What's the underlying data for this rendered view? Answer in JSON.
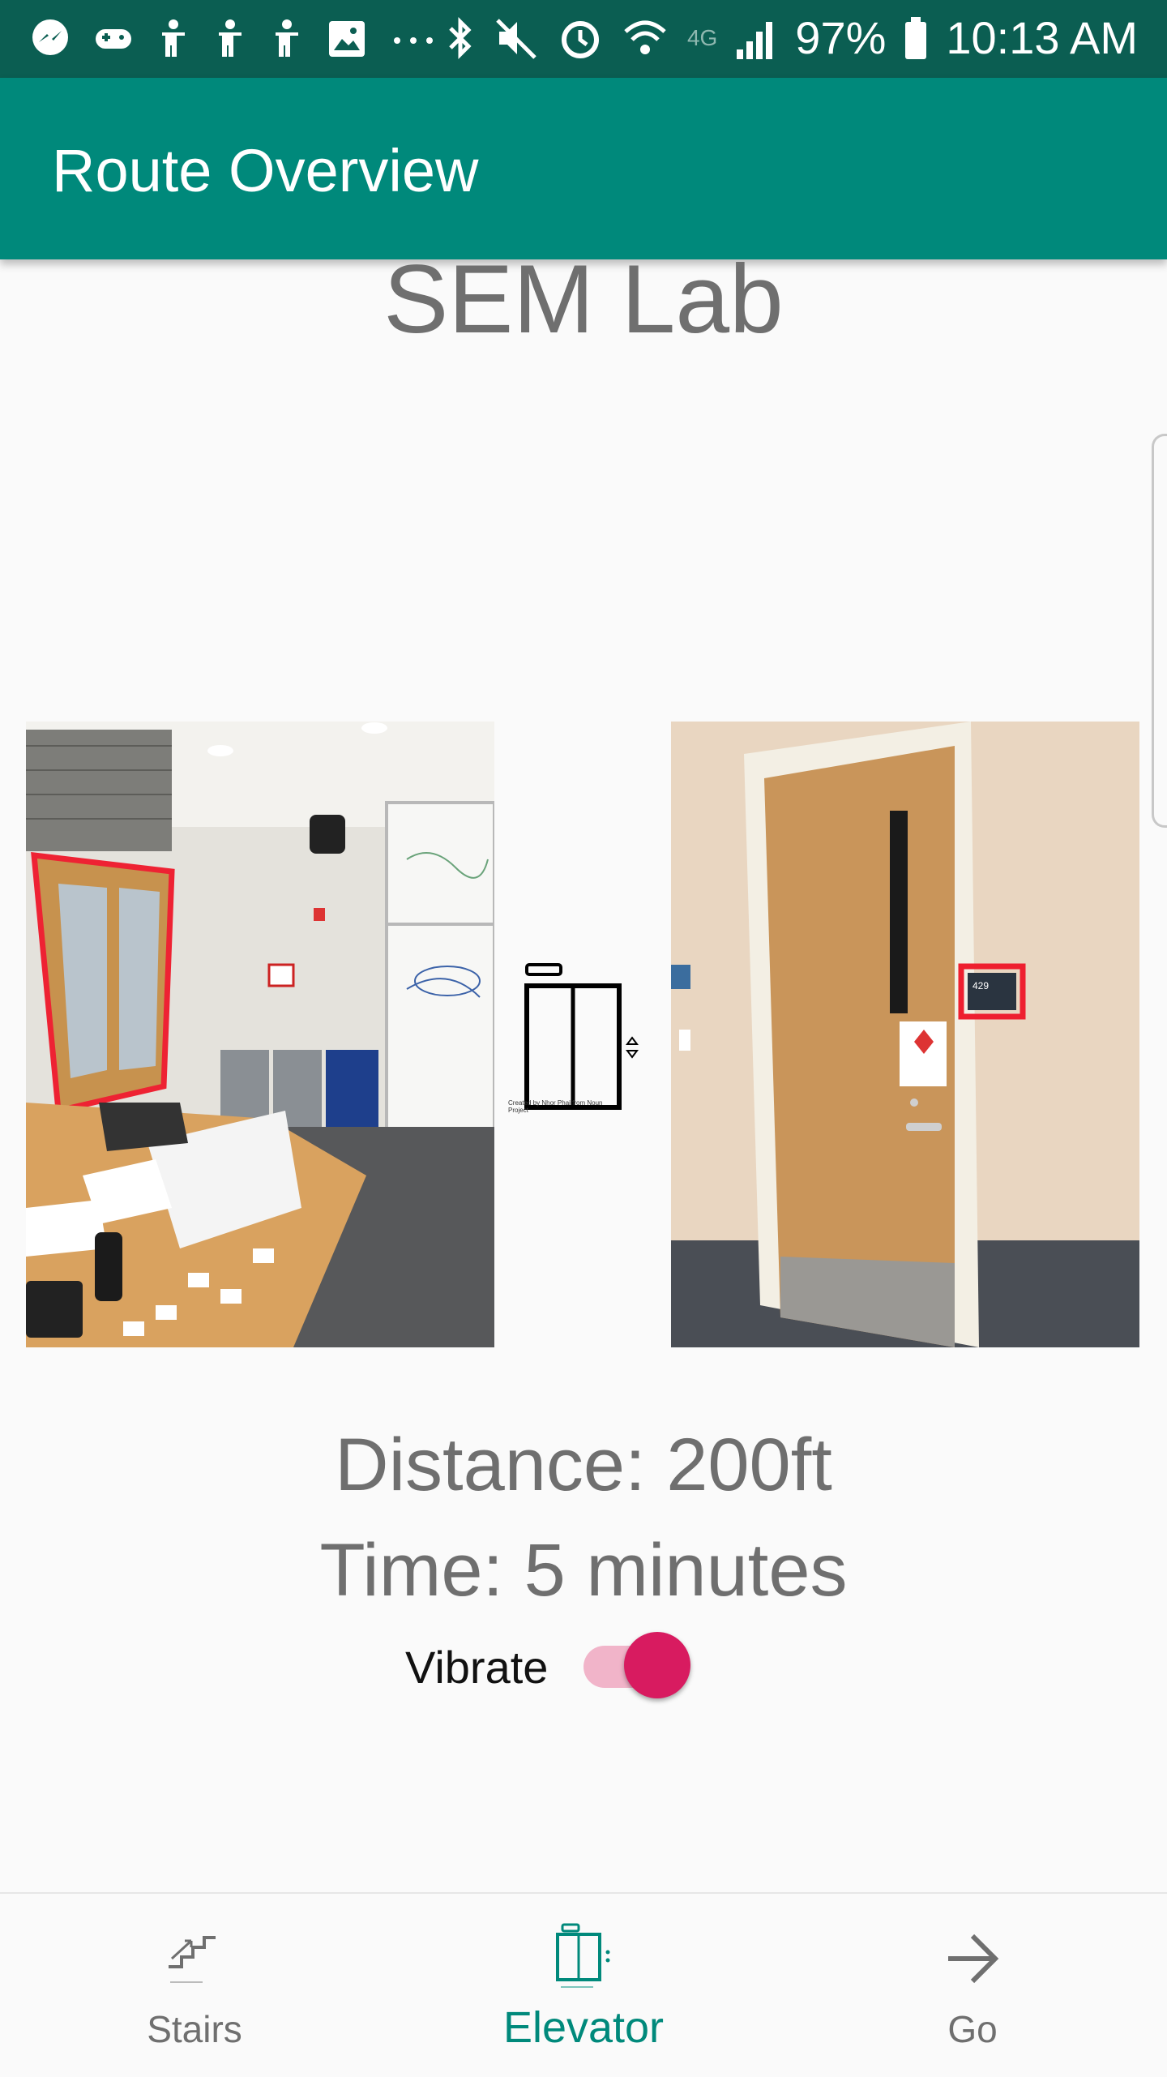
{
  "status_bar": {
    "battery_percent": "97%",
    "time": "10:13 AM",
    "network": "4G",
    "left_icons": [
      "messenger-icon",
      "game-controller-icon",
      "accessibility-icon",
      "accessibility-icon",
      "accessibility-icon",
      "image-icon",
      "more-dots-icon"
    ],
    "right_icons": [
      "bluetooth-icon",
      "mute-vibrate-icon",
      "alarm-icon",
      "wifi-icon",
      "signal-icon",
      "battery-icon"
    ]
  },
  "app_bar": {
    "title": "Route Overview"
  },
  "destination": {
    "name": "SEM Lab"
  },
  "route": {
    "start_photo_alt": "Room with doors highlighted in red",
    "end_photo_alt": "Door with room sign 429 highlighted",
    "room_number": "429",
    "transition_icon": "elevator-icon",
    "icon_credit": "Created by Nhor Phai from Noun Project",
    "distance": "Distance: 200ft",
    "time": "Time: 5 minutes"
  },
  "vibrate": {
    "label": "Vibrate",
    "enabled": true
  },
  "bottom_nav": {
    "active_index": 1,
    "items": [
      {
        "label": "Stairs",
        "icon": "stairs-icon"
      },
      {
        "label": "Elevator",
        "icon": "elevator-icon"
      },
      {
        "label": "Go",
        "icon": "arrow-right-icon"
      }
    ]
  },
  "colors": {
    "status_bar": "#0b5e52",
    "app_bar": "#00897b",
    "accent": "#d81b60",
    "active_tab": "#00897b"
  }
}
